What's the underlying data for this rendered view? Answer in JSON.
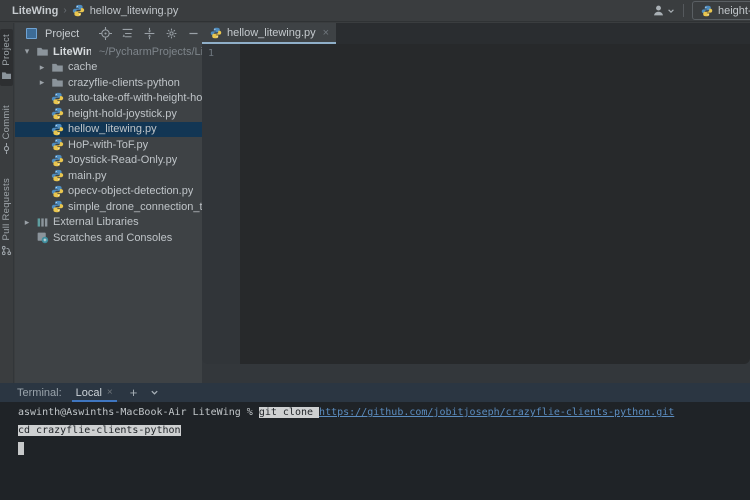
{
  "colors": {
    "accent_blue": "#3f76c0",
    "tree_selection": "#123654",
    "link_blue": "#5b8cbf",
    "terminal_highlight": "#ced0d1",
    "tab_underline": "#8fafc9"
  },
  "topbar": {
    "breadcrumb_project": "LiteWing",
    "breadcrumb_separator": "›",
    "breadcrumb_file": "hellow_litewing.py",
    "run_config": "height-h"
  },
  "stripe": {
    "items": [
      {
        "label": "Project"
      },
      {
        "label": "Commit"
      },
      {
        "label": "Pull Requests"
      }
    ]
  },
  "project": {
    "header_title": "Project",
    "tree": [
      {
        "label": "LiteWing",
        "path": "~/PycharmProjects/LiteWi"
      },
      {
        "label": "cache"
      },
      {
        "label": "crazyflie-clients-python"
      },
      {
        "label": "auto-take-off-with-height-hold-j"
      },
      {
        "label": "height-hold-joystick.py"
      },
      {
        "label": "hellow_litewing.py"
      },
      {
        "label": "HoP-with-ToF.py"
      },
      {
        "label": "Joystick-Read-Only.py"
      },
      {
        "label": "main.py"
      },
      {
        "label": "opecv-object-detection.py"
      },
      {
        "label": "simple_drone_connection_test.py"
      },
      {
        "label": "External Libraries"
      },
      {
        "label": "Scratches and Consoles"
      }
    ]
  },
  "editor": {
    "tab_label": "hellow_litewing.py",
    "tab_close": "×",
    "line_number": "1"
  },
  "terminal": {
    "panel_label": "Terminal:",
    "tab_label": "Local",
    "tab_close": "×",
    "new_tab": "+",
    "prompt": "aswinth@Aswinths-MacBook-Air LiteWing % ",
    "command_1": "git clone ",
    "url": "https://github.com/jobitjoseph/crazyflie-clients-python.git",
    "command_2": "cd crazyflie-clients-python"
  }
}
